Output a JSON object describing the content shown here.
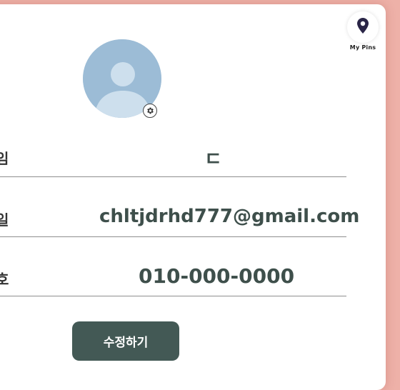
{
  "header": {
    "pins_label": "My Pins",
    "pins_icon": "map-pin-icon"
  },
  "profile": {
    "avatar_icon": "user-avatar-icon",
    "settings_icon": "gear-icon",
    "colors": {
      "avatar_bg": "#9cbcd6",
      "avatar_figure": "#cddfed"
    }
  },
  "fields": {
    "name": {
      "label": "임",
      "value": "ㄷ"
    },
    "email": {
      "label": "일",
      "value": "chltjdrhd777@gmail.com"
    },
    "phone": {
      "label": "호",
      "value": "010-000-0000"
    }
  },
  "actions": {
    "edit_label": "수정하기"
  },
  "colors": {
    "page_bg": "#eeb1a8",
    "card_bg": "#ffffff",
    "accent": "#435955",
    "value_text": "#3e4f4b"
  }
}
